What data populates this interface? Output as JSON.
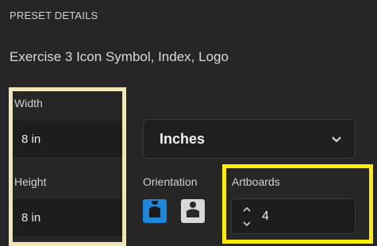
{
  "section_title": "PRESET DETAILS",
  "preset_name": "Exercise 3 Icon Symbol, Index, Logo",
  "width": {
    "label": "Width",
    "value": "8 in"
  },
  "height": {
    "label": "Height",
    "value": "8 in"
  },
  "units": {
    "selected": "Inches"
  },
  "orientation": {
    "label": "Orientation",
    "selected": "portrait"
  },
  "artboards": {
    "label": "Artboards",
    "value": "4"
  },
  "colors": {
    "accent": "#1e88d6",
    "highlight_cream": "#f0e6b8",
    "highlight_yellow": "#ffee00"
  }
}
